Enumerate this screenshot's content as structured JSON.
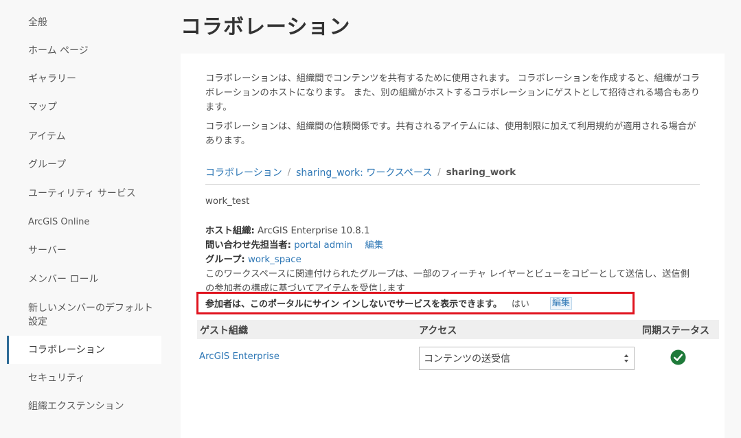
{
  "sidebar": {
    "items": [
      {
        "label": "全般"
      },
      {
        "label": "ホーム ページ"
      },
      {
        "label": "ギャラリー"
      },
      {
        "label": "マップ"
      },
      {
        "label": "アイテム"
      },
      {
        "label": "グループ"
      },
      {
        "label": "ユーティリティ サービス"
      },
      {
        "label": "ArcGIS Online"
      },
      {
        "label": "サーバー"
      },
      {
        "label": "メンバー ロール"
      },
      {
        "label": "新しいメンバーのデフォルト設定"
      },
      {
        "label": "コラボレーション",
        "active": true
      },
      {
        "label": "セキュリティ"
      },
      {
        "label": "組織エクステンション"
      }
    ]
  },
  "page": {
    "title": "コラボレーション"
  },
  "intro": {
    "p1": "コラボレーションは、組織間でコンテンツを共有するために使用されます。 コラボレーションを作成すると、組織がコラボレーションのホストになります。 また、別の組織がホストするコラボレーションにゲストとして招待される場合もあります。",
    "p2": "コラボレーションは、組織間の信頼関係です。共有されるアイテムには、使用制限に加えて利用規約が適用される場合があります。"
  },
  "breadcrumb": {
    "item1": "コラボレーション",
    "item2": "sharing_work: ワークスペース",
    "current": "sharing_work",
    "sep": "/"
  },
  "workspace": {
    "name": "work_test",
    "host_label": "ホスト組織:",
    "host_value": "ArcGIS Enterprise 10.8.1",
    "contact_label": "問い合わせ先担当者:",
    "contact_value": "portal admin",
    "contact_edit": "編集",
    "group_label": "グループ:",
    "group_value": "work_space",
    "description": "このワークスペースに関連付けられたグループは、一部のフィーチャ レイヤーとビューをコピーとして送信し、送信側の参加者の構成に基づいてアイテムを受信します",
    "guest_view_label": "参加者は、このポータルにサイン インしないでサービスを表示できます。",
    "guest_view_value": "はい",
    "guest_view_edit": "編集"
  },
  "table": {
    "headers": {
      "org": "ゲスト組織",
      "access": "アクセス",
      "sync": "同期ステータス"
    },
    "rows": [
      {
        "org": "ArcGIS Enterprise",
        "access": "コンテンツの送受信",
        "sync_icon": "check-circle-icon"
      }
    ]
  },
  "colors": {
    "accent": "#2e77b5",
    "highlight": "#e0131e",
    "success": "#1f7a3a"
  }
}
